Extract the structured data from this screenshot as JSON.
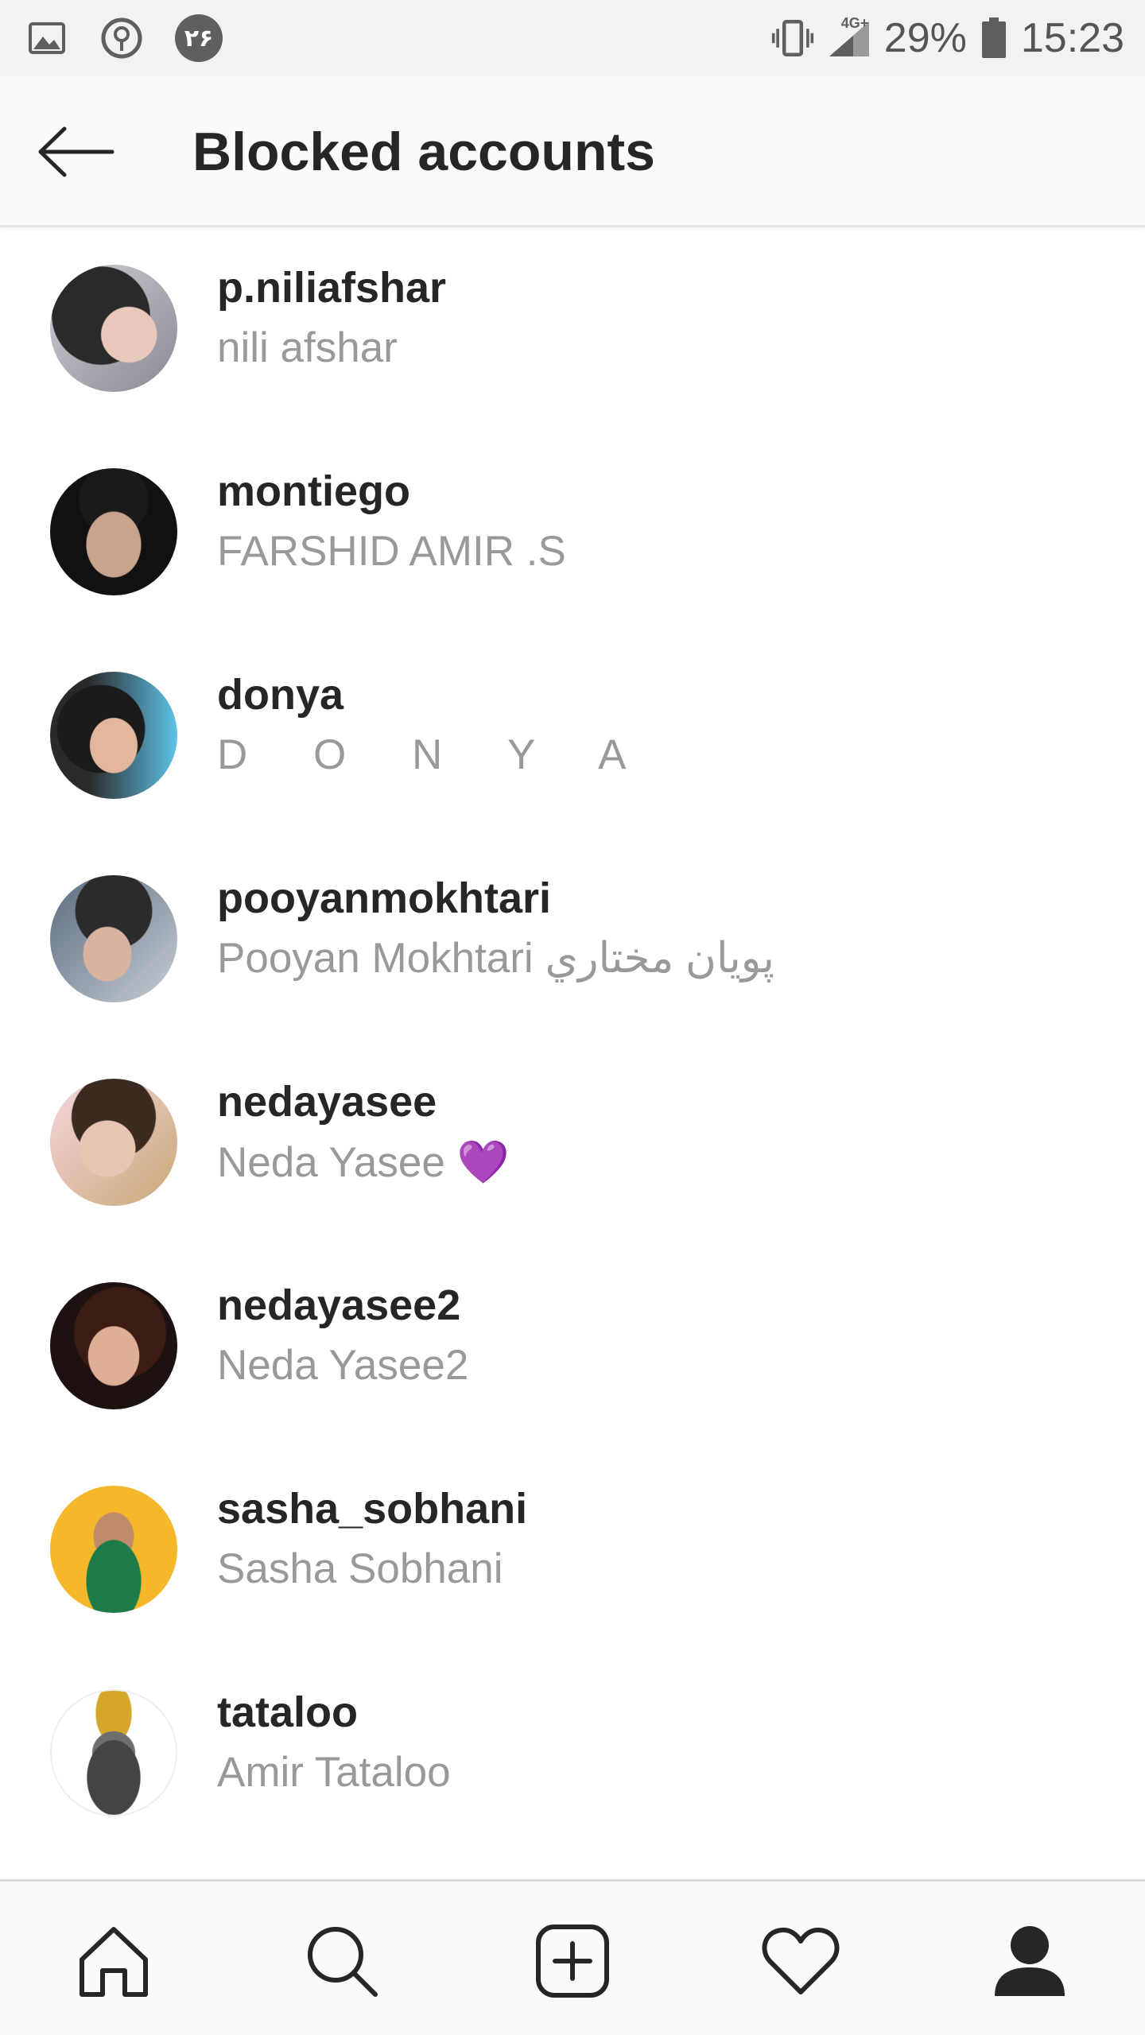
{
  "status_bar": {
    "badge_number": "۲۶",
    "network": "4G+",
    "battery": "29%",
    "time": "15:23",
    "icons": [
      "image-icon",
      "sync-icon",
      "vibrate-icon",
      "signal-icon",
      "battery-icon"
    ]
  },
  "header": {
    "title": "Blocked accounts",
    "back_icon": "back-arrow-icon"
  },
  "accounts": [
    {
      "username": "p.niliafshar",
      "full_name": "nili afshar"
    },
    {
      "username": "montiego",
      "full_name": "FARSHID AMIR .S"
    },
    {
      "username": "donya",
      "full_name": "D O N Y A"
    },
    {
      "username": "pooyanmokhtari",
      "full_name": "Pooyan Mokhtari پویان مختاري"
    },
    {
      "username": "nedayasee",
      "full_name": "Neda Yasee 💜"
    },
    {
      "username": "nedayasee2",
      "full_name": "Neda Yasee2"
    },
    {
      "username": "sasha_sobhani",
      "full_name": "Sasha Sobhani"
    },
    {
      "username": "tataloo",
      "full_name": "Amir Tataloo"
    }
  ],
  "bottom_nav": [
    "home-icon",
    "search-icon",
    "add-post-icon",
    "activity-heart-icon",
    "profile-icon"
  ],
  "colors": {
    "text_primary": "#262626",
    "text_secondary": "#999999",
    "status_bar_bg": "#f2f2f2",
    "nav_bg": "#fafafa"
  }
}
